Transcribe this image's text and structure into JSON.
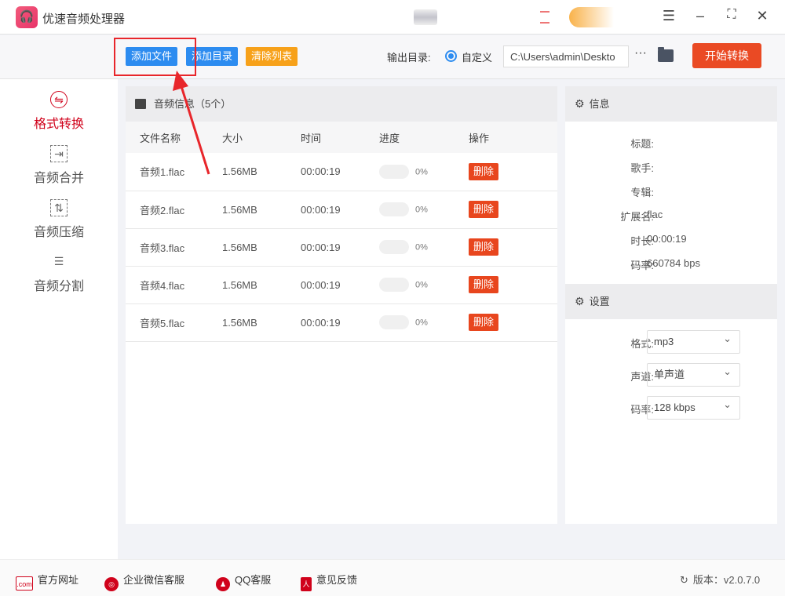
{
  "app": {
    "title": "优速音频处理器"
  },
  "toolbar": {
    "add_file": "添加文件",
    "add_dir": "添加目录",
    "clear_list": "清除列表",
    "output_label": "输出目录:",
    "radio_label": "自定义",
    "output_path": "C:\\Users\\admin\\Deskto",
    "more": "···",
    "start": "开始转换"
  },
  "sidebar": {
    "items": [
      {
        "label": "格式转换",
        "icon": "convert-icon",
        "active": true
      },
      {
        "label": "音频合并",
        "icon": "merge-icon"
      },
      {
        "label": "音频压缩",
        "icon": "compress-icon"
      },
      {
        "label": "音频分割",
        "icon": "split-icon"
      }
    ]
  },
  "list": {
    "title": "音频信息（5个）",
    "columns": [
      "文件名称",
      "大小",
      "时间",
      "进度",
      "操作"
    ],
    "rows": [
      {
        "name": "音频1.flac",
        "size": "1.56MB",
        "time": "00:00:19",
        "progress": "0%",
        "action": "删除"
      },
      {
        "name": "音频2.flac",
        "size": "1.56MB",
        "time": "00:00:19",
        "progress": "0%",
        "action": "删除"
      },
      {
        "name": "音频3.flac",
        "size": "1.56MB",
        "time": "00:00:19",
        "progress": "0%",
        "action": "删除"
      },
      {
        "name": "音频4.flac",
        "size": "1.56MB",
        "time": "00:00:19",
        "progress": "0%",
        "action": "删除"
      },
      {
        "name": "音频5.flac",
        "size": "1.56MB",
        "time": "00:00:19",
        "progress": "0%",
        "action": "删除"
      }
    ]
  },
  "info": {
    "title": "信息",
    "fields": [
      {
        "k": "标题:",
        "v": ""
      },
      {
        "k": "歌手:",
        "v": ""
      },
      {
        "k": "专辑:",
        "v": ""
      },
      {
        "k": "扩展名:",
        "v": "flac"
      },
      {
        "k": "时长:",
        "v": "00:00:19"
      },
      {
        "k": "码率:",
        "v": "660784 bps"
      }
    ]
  },
  "settings": {
    "title": "设置",
    "fields": [
      {
        "k": "格式:",
        "v": "mp3"
      },
      {
        "k": "声道:",
        "v": "单声道"
      },
      {
        "k": "码率:",
        "v": "128 kbps"
      }
    ]
  },
  "footer": {
    "website": "官方网址",
    "wechat": "企业微信客服",
    "qq": "QQ客服",
    "feedback": "意见反馈",
    "version": "版本：v2.0.7.0"
  },
  "colors": {
    "accent": "#2d8cf0",
    "danger": "#ea4a24",
    "warning": "#f7a11a",
    "active": "#d0021b"
  }
}
